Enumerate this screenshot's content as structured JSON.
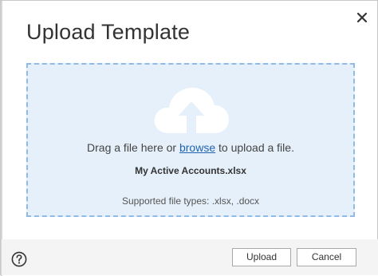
{
  "dialog": {
    "title": "Upload Template",
    "close_icon": "close-icon"
  },
  "dropzone": {
    "icon": "cloud-upload-icon",
    "text_before": "Drag a file here or ",
    "browse_link": "browse",
    "text_after": " to upload a file.",
    "file_name": "My Active Accounts.xlsx",
    "supported_types": "Supported file types: .xlsx, .docx"
  },
  "footer": {
    "help_icon": "help-icon",
    "upload_label": "Upload",
    "cancel_label": "Cancel"
  },
  "colors": {
    "dropzone_background": "#e5f0fa",
    "dropzone_border": "#8fbbe6",
    "link": "#1f62b0",
    "footer_background": "#f4f4f4"
  }
}
